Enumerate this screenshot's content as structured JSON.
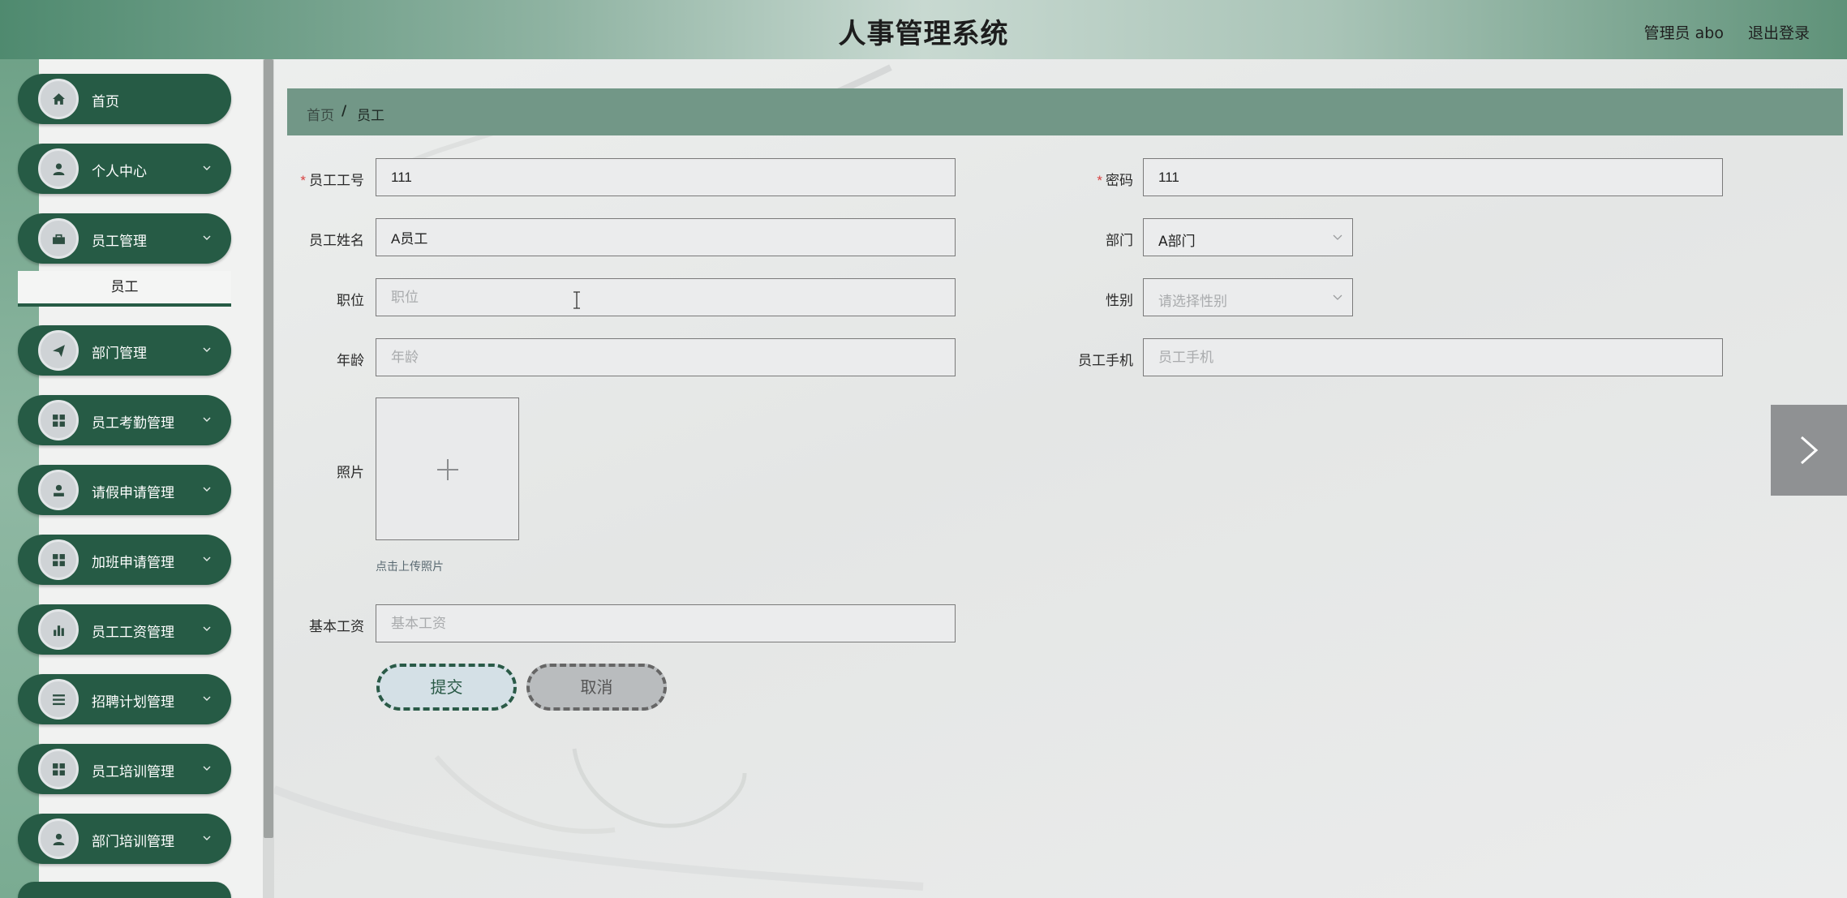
{
  "header": {
    "title": "人事管理系统",
    "user": "管理员 abo",
    "logout": "退出登录"
  },
  "sidebar": {
    "items": [
      {
        "label": "首页",
        "icon": "home-icon"
      },
      {
        "label": "个人中心",
        "icon": "user-icon"
      },
      {
        "label": "员工管理",
        "icon": "briefcase-icon"
      },
      {
        "label": "部门管理",
        "icon": "send-icon"
      },
      {
        "label": "员工考勤管理",
        "icon": "grid-icon"
      },
      {
        "label": "请假申请管理",
        "icon": "user-icon"
      },
      {
        "label": "加班申请管理",
        "icon": "grid-icon"
      },
      {
        "label": "员工工资管理",
        "icon": "bar-chart-icon"
      },
      {
        "label": "招聘计划管理",
        "icon": "list-icon"
      },
      {
        "label": "员工培训管理",
        "icon": "grid-icon"
      },
      {
        "label": "部门培训管理",
        "icon": "user-icon"
      }
    ],
    "submenu": {
      "label": "员工"
    }
  },
  "breadcrumb": {
    "home": "首页",
    "separator": "/",
    "current": "员工"
  },
  "form": {
    "employee_no": {
      "label": "员工工号",
      "value": "111",
      "required": true
    },
    "password": {
      "label": "密码",
      "value": "111",
      "required": true
    },
    "employee_name": {
      "label": "员工姓名",
      "value": "A员工"
    },
    "department": {
      "label": "部门",
      "value": "A部门"
    },
    "position": {
      "label": "职位",
      "placeholder": "职位"
    },
    "gender": {
      "label": "性别",
      "placeholder": "请选择性别"
    },
    "age": {
      "label": "年龄",
      "placeholder": "年龄"
    },
    "phone": {
      "label": "员工手机",
      "placeholder": "员工手机"
    },
    "photo": {
      "label": "照片",
      "hint": "点击上传照片"
    },
    "base_salary": {
      "label": "基本工资",
      "placeholder": "基本工资"
    },
    "required_mark": "*",
    "submit_label": "提交",
    "cancel_label": "取消"
  },
  "colors": {
    "sidebar_item": "#265b45",
    "breadcrumb_bar": "#729787",
    "required": "#d84040"
  }
}
